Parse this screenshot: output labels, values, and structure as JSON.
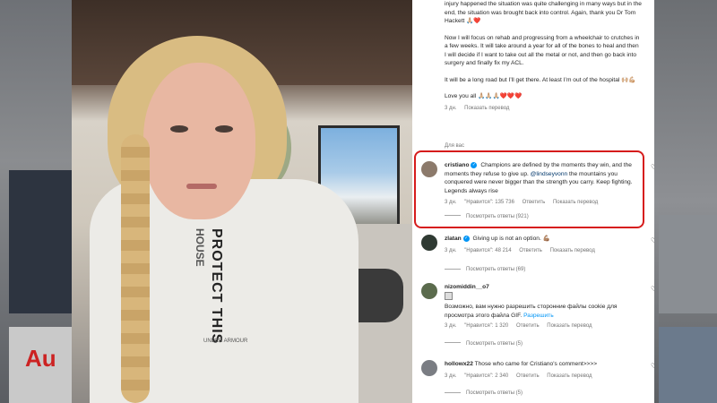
{
  "caption": {
    "paragraphs": [
      "injury happened the situation was quite challenging in many ways but in the end, the situation was brought back into control. Again, thank you Dr Tom Hackett 🙏🏼❤️",
      "Now I will focus on rehab and progressing from a wheelchair to crutches in a few weeks. It will take around a year for all of the bones to heal and then I will decide if I want to take out all the metal or not, and then go back into surgery and finally fix my ACL.",
      "It will be a long road but I’ll get there. At least I’m out of the hospital 🙌🏼💪🏼",
      "Love you all 🙏🏼🙏🏼🙏🏼❤️❤️❤️"
    ],
    "meta": {
      "time": "3 дн.",
      "action": "Показать перевод"
    },
    "see_all": "Для вас"
  },
  "comments": [
    {
      "username": "cristiano",
      "verified": true,
      "text_before": "Champions are defined by the moments they win, and the moments they refuse to give up. ",
      "mention": "@lindseyvonn",
      "text_after": " the mountains you conquered were never bigger than the strength you carry. Keep fighting. Legends always rise",
      "time": "3 дн.",
      "likes": "\"Нравится\": 135 736",
      "reply": "Ответить",
      "translate": "Показать перевод",
      "replies": "Посмотреть ответы (921)",
      "avatar_color": "#8c7a6b"
    },
    {
      "username": "zlatan",
      "verified": true,
      "text": "Giving up is not an option. 💪🏽",
      "time": "3 дн.",
      "likes": "\"Нравится\": 48 214",
      "reply": "Ответить",
      "translate": "Показать перевод",
      "replies": "Посмотреть ответы (69)",
      "avatar_color": "#2f3a33"
    },
    {
      "username": "nizomiddin__o7",
      "verified": false,
      "text": "Возможно, вам нужно разрешить сторонние файлы cookie для просмотра этого файла GIF. ",
      "allow": "Разрешить",
      "time": "3 дн.",
      "likes": "\"Нравится\": 1 320",
      "reply": "Ответить",
      "translate": "Показать перевод",
      "replies": "Посмотреть ответы (5)",
      "avatar_color": "#5b6b4d"
    },
    {
      "username": "hollowx22",
      "verified": false,
      "text": "Those who came for Cristiano's comment>>>>",
      "time": "3 дн.",
      "likes": "\"Нравится\": 2 340",
      "reply": "Ответить",
      "translate": "Показать перевод",
      "replies": "Посмотреть ответы (5)",
      "avatar_color": "#7a7d83"
    }
  ],
  "photo": {
    "hoodie_text": "PROTECT THIS",
    "hoodie_text2": "HOUSE",
    "hoodie_brand": "UNDER ARMOUR"
  },
  "background": {
    "left_thumb_text": "Au"
  },
  "colors": {
    "highlight_box": "#d61c1c",
    "verified": "#0095f6",
    "link": "#00376b"
  }
}
